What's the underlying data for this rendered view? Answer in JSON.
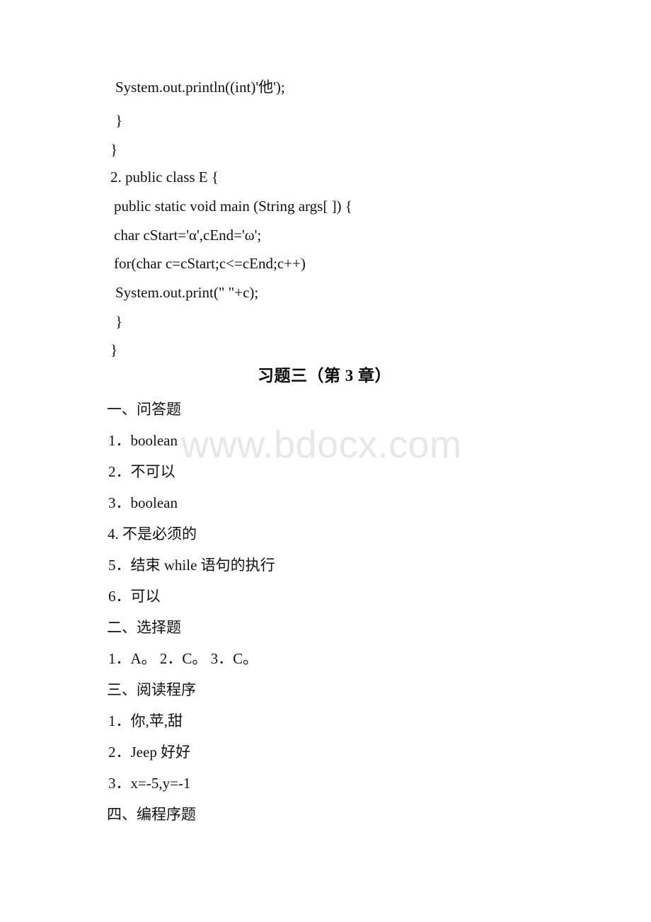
{
  "document": {
    "page_background": "#ffffff",
    "text_color": "#111111"
  },
  "watermark": {
    "text": "www.bdocx.com",
    "color": "#e7e7e7"
  },
  "code_block_1": {
    "lines": [
      "System.out.println((int)'他');",
      "}",
      "}"
    ]
  },
  "code_block_2": {
    "lines": [
      "2. public class E {",
      "public static void main (String args[ ]) {",
      "char cStart='α',cEnd='ω';",
      "for(char c=cStart;c<=cEnd;c++)",
      "System.out.print(\" \"+c);",
      "}",
      "}"
    ]
  },
  "exercise_title": "习题三（第 3 章）",
  "sections": [
    {
      "heading": "一、问答题",
      "answers": [
        "1．boolean",
        "2．不可以",
        "3．boolean",
        "4. 不是必须的",
        "5．结束 while 语句的执行",
        "6．可以"
      ]
    },
    {
      "heading": "二、选择题",
      "answers": [
        "1．A。 2．C。 3．C。"
      ]
    },
    {
      "heading": "三、阅读程序",
      "answers": [
        "1．你,苹,甜",
        "2．Jeep 好好",
        "3．x=-5,y=-1"
      ]
    },
    {
      "heading": "四、编程序题",
      "answers": []
    }
  ]
}
